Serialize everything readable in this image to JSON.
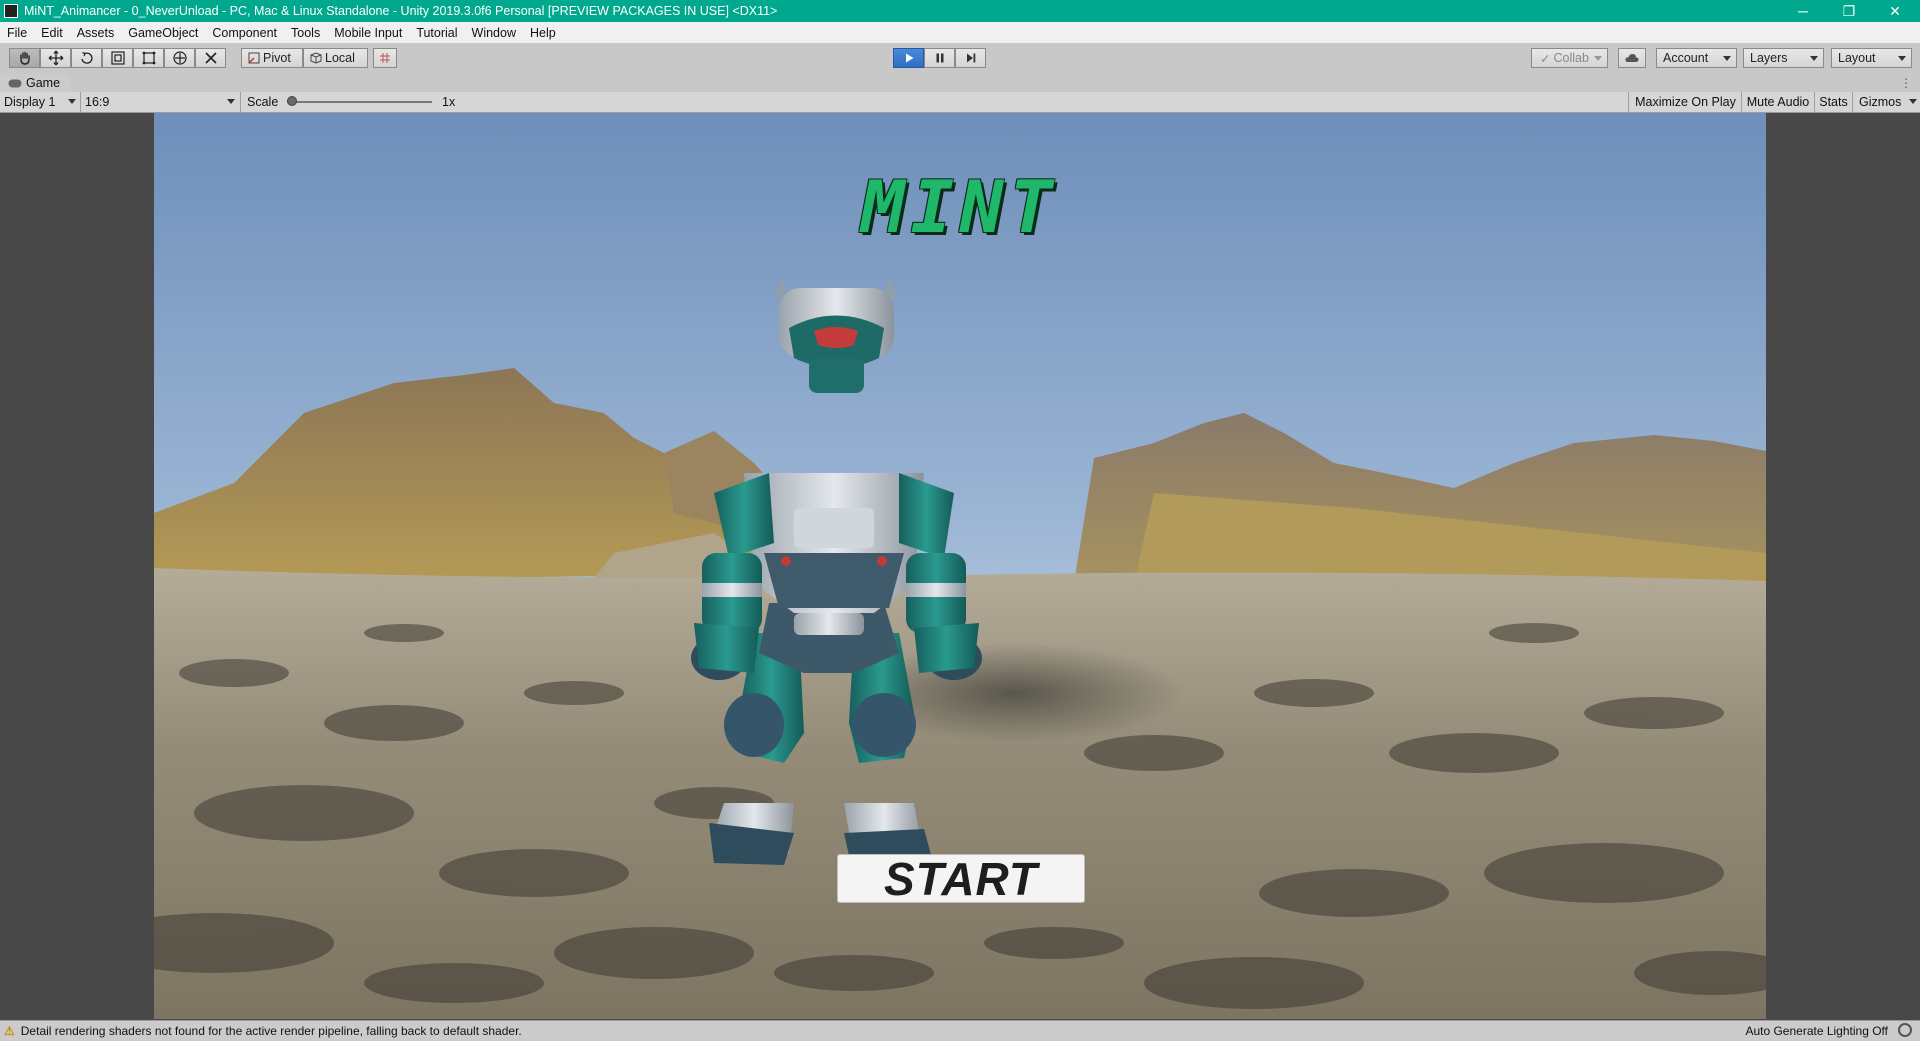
{
  "window": {
    "title": "MiNT_Animancer - 0_NeverUnload - PC, Mac & Linux Standalone - Unity 2019.3.0f6 Personal [PREVIEW PACKAGES IN USE] <DX11>",
    "controls": {
      "minimize": "─",
      "restore": "❐",
      "close": "✕"
    }
  },
  "menu": [
    "File",
    "Edit",
    "Assets",
    "GameObject",
    "Component",
    "Tools",
    "Mobile Input",
    "Tutorial",
    "Window",
    "Help"
  ],
  "toolbar": {
    "pivot_label": "Pivot",
    "local_label": "Local",
    "collab_label": "Collab",
    "account_label": "Account",
    "layers_label": "Layers",
    "layout_label": "Layout",
    "play_state": "playing"
  },
  "game_tab": {
    "label": "Game"
  },
  "game_bar": {
    "display": "Display 1",
    "aspect": "16:9",
    "scale_label": "Scale",
    "scale_value": "1x",
    "scale_fraction": 0.0,
    "maximize": "Maximize On Play",
    "mute": "Mute Audio",
    "stats": "Stats",
    "gizmos": "Gizmos"
  },
  "game": {
    "logo_text": "MINT",
    "start_label": "START"
  },
  "status": {
    "message": "Detail rendering shaders not found for the active render pipeline, falling back to default shader.",
    "right": "Auto Generate Lighting Off"
  },
  "colors": {
    "titlebar": "#00a98d",
    "logo_green": "#1fb86a",
    "robot_teal": "#1f8a80",
    "sky": "#8fb0d6",
    "ground": "#8f8877"
  }
}
